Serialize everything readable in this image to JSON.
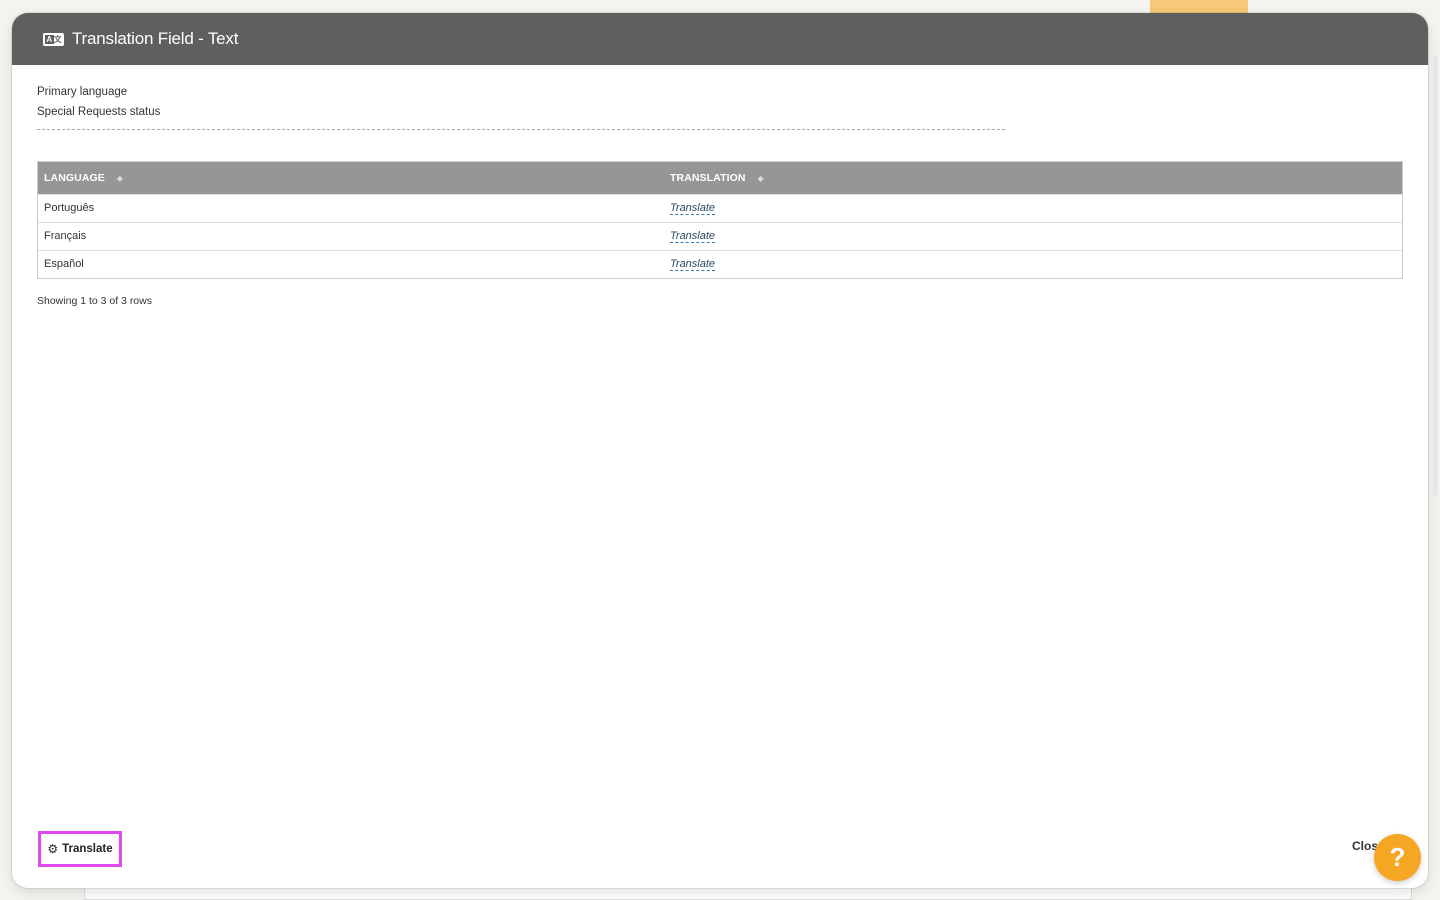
{
  "modal": {
    "title": "Translation Field - Text",
    "header_icon": "translate-icon"
  },
  "info": {
    "primary_language_label": "Primary language",
    "field_name": "Special Requests status"
  },
  "table": {
    "columns": [
      {
        "label": "LANGUAGE"
      },
      {
        "label": "TRANSLATION"
      }
    ],
    "sort_icon": "sort-icon",
    "rows": [
      {
        "language": "Português",
        "translation": "Translate"
      },
      {
        "language": "Français",
        "translation": "Translate"
      },
      {
        "language": "Español",
        "translation": "Translate"
      }
    ],
    "rows_info": "Showing 1 to 3 of 3 rows"
  },
  "footer": {
    "translate_label": "Translate",
    "translate_icon": "gear-icon",
    "close_label": "Clos"
  },
  "help": {
    "label": "?"
  },
  "colors": {
    "header_bg": "#5f5f5f",
    "table_header_bg": "#969696",
    "highlight_border": "#e048f0",
    "help_button": "#f5a623",
    "tab_accent": "#f9c97a"
  }
}
